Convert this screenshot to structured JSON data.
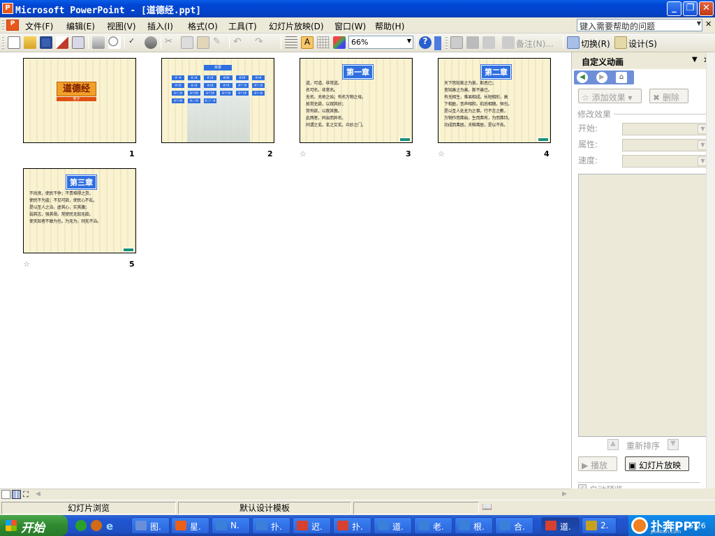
{
  "window": {
    "title": "Microsoft PowerPoint - [道德经.ppt]",
    "app_icon": "P",
    "buttons": [
      "minimize-icon",
      "restore-icon",
      "close-icon"
    ]
  },
  "menu": {
    "items": [
      "文件(F)",
      "编辑(E)",
      "视图(V)",
      "插入(I)",
      "格式(O)",
      "工具(T)",
      "幻灯片放映(D)",
      "窗口(W)",
      "帮助(H)"
    ],
    "help_placeholder": "键入需要帮助的问题"
  },
  "toolbar": {
    "zoom": "66%",
    "notes_label": "备注(N)...",
    "transition_label": "切换(R)",
    "design_label": "设计(S)"
  },
  "slides": [
    {
      "number": "1",
      "title": "道德经",
      "subtitle": "老子",
      "has_animation": false
    },
    {
      "number": "2",
      "title": "目录",
      "has_animation": false,
      "toc": [
        "第一章",
        "第二章",
        "第三章",
        "第四章",
        "第五章",
        "第六章",
        "第七章",
        "第八章",
        "第九章",
        "第十章",
        "第十一章",
        "第十二章",
        "第十三章",
        "第十四章",
        "第十五章",
        "第十六章",
        "第十七章",
        "第十八章",
        "第十九章",
        "第二十章",
        "第二十一章"
      ]
    },
    {
      "number": "3",
      "title": "第一章",
      "has_animation": true,
      "lines": [
        "道，可道，非常道。",
        "名可名，非常名。",
        "无名，天地之始；有名万物之母。",
        "故常无欲，以观其妙；",
        "常有欲，以观其徼。",
        "此两者，同出而异名，",
        "同谓之玄。玄之又玄，众妙之门。"
      ]
    },
    {
      "number": "4",
      "title": "第二章",
      "has_animation": true,
      "lines": [
        "天下皆知美之为美，斯恶已；",
        "皆知善之为善，斯不善已。",
        "有无相生，难易相成，长短相形，高",
        "下相盈，音声相和，前后相随，恒也。",
        "是以圣人处无为之事，行不言之教，",
        "万物作而弗始，生而弗有，为而弗恃，",
        "功成而弗居。夫唯弗居，是以不去。"
      ]
    },
    {
      "number": "5",
      "title": "第三章",
      "has_animation": true,
      "lines": [
        "不尚贤，使民不争；不贵难得之货，",
        "使民不为盗；不见可欲，使民心不乱。",
        "是以圣人之治，虚其心，实其腹；",
        "弱其志，强其骨。常使民无知无欲。",
        "使夫知者不敢为也。为无为，则无不治。"
      ]
    }
  ],
  "taskpane": {
    "title": "自定义动画",
    "add_effect": "添加效果",
    "remove": "删除",
    "modify_section": "修改效果",
    "start_label": "开始:",
    "property_label": "属性:",
    "speed_label": "速度:",
    "reorder": "重新排序",
    "play": "播放",
    "slideshow": "幻灯片放映",
    "autopreview": "自动预览"
  },
  "status": {
    "view": "幻灯片浏览",
    "template": "默认设计模板"
  },
  "taskbar": {
    "start": "开始",
    "buttons": [
      "图.",
      "星.",
      "N.",
      "扑.",
      "迟.",
      "扑.",
      "道.",
      "老.",
      "根.",
      "合.",
      "道.",
      "2."
    ],
    "clock": "5:26",
    "watermark": "扑奔PPT",
    "watermark_url": "pooban.com"
  },
  "colors": {
    "title_blue": "#0046d5",
    "chapter_blue": "#2f6fe0",
    "slide_bg": "#faf3d2",
    "title_orange": "#f0a028"
  }
}
